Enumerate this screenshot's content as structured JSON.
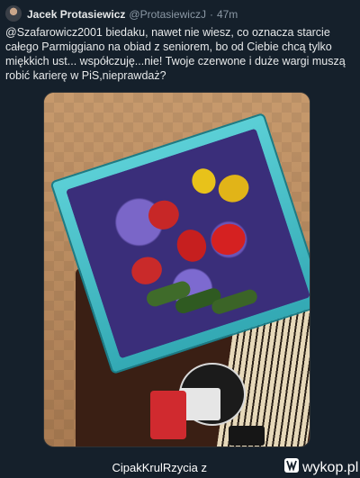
{
  "tweet": {
    "author_name": "Jacek Protasiewicz",
    "handle": "@ProtasiewiczJ",
    "separator": "·",
    "time": "47m",
    "text": "@Szafarowicz2001 biedaku, nawet nie wiesz, co oznacza starcie całego Parmiggiano na obiad z seniorem, bo od Ciebie chcą tylko miękkich ust... współczuję...nie! Twoje czerwone i duże wargi muszą robić karierę w PiS,nieprawdaż?"
  },
  "footer": {
    "watermark_user": "CipakKrulRzycia z",
    "watermark_site": "wykop.pl"
  },
  "colors": {
    "background": "#15202b",
    "text_primary": "#e7e9ea",
    "text_secondary": "#8b98a5",
    "box_teal": "#33a9b4"
  }
}
